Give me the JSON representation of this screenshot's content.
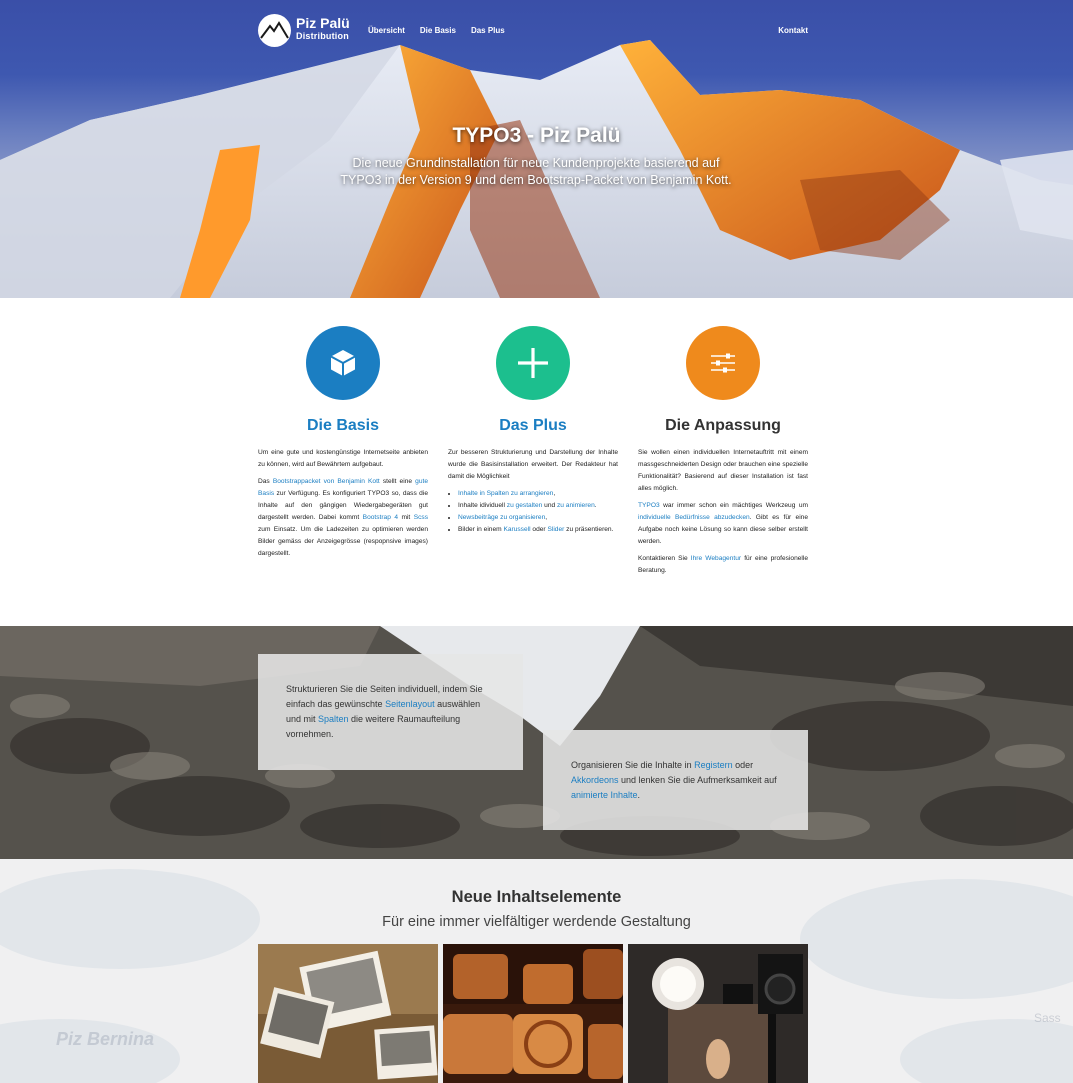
{
  "header": {
    "logo_line1": "Piz Palü",
    "logo_line2": "Distribution",
    "nav": [
      "Übersicht",
      "Die Basis",
      "Das Plus"
    ],
    "contact": "Kontakt"
  },
  "hero": {
    "title": "TYPO3 - Piz Palü",
    "subtitle": "Die neue Grundinstallation für neue Kundenprojekte basierend auf TYPO3 in der Version 9 und dem Bootstrap-Packet von Benjamin Kott."
  },
  "features": {
    "basis": {
      "title": "Die Basis",
      "color": "#1b7ec2",
      "icon": "cube-icon",
      "p1": "Um eine gute und kostengünstige Internetseite anbieten zu können, wird auf Bewährtem aufgebaut.",
      "p2_a": "Das ",
      "p2_link1": "Bootstrappacket von Benjamin Kott",
      "p2_b": " stellt eine ",
      "p2_link2": "gute Basis",
      "p2_c": " zur Verfügung. Es konfiguriert TYPO3 so, dass die Inhalte auf den gängigen Wiedergabegeräten gut dargestellt werden. Dabei kommt ",
      "p2_link3": "Bootstrap 4",
      "p2_d": " mit ",
      "p2_link4": "Scss",
      "p2_e": " zum Einsatz. Um die Ladezeiten zu optimieren werden Bilder gemäss der Anzeigegrösse (respopnsive images) dargestellt."
    },
    "plus": {
      "title": "Das Plus",
      "color": "#1cbf8e",
      "icon": "plus-icon",
      "p1": "Zur besseren Strukturierung und Darstellung der Inhalte wurde die Basisinstallation erweitert. Der Redakteur hat damit die Möglichkeit",
      "li1_link": "Inhalte in Spalten zu arrangieren",
      "li1_after": ",",
      "li2_before": "Inhalte idividuell ",
      "li2_link": "zu gestalten",
      "li2_mid": " und ",
      "li2_link2": "zu animieren",
      "li2_after": ".",
      "li3_link": "Newsbeiträge zu organisieren",
      "li3_after": ",",
      "li4_before": "Bilder in einem ",
      "li4_link1": "Karussell",
      "li4_mid": " oder ",
      "li4_link2": "Slider",
      "li4_after": " zu präsentieren."
    },
    "anpassung": {
      "title": "Die Anpassung",
      "color": "#ef8a1c",
      "icon": "sliders-icon",
      "p1": "Sie wollen einen individuellen Internetauftritt mit einem massgeschneiderten Design oder brauchen eine spezielle Funktionalität? Basierend auf dieser Installation ist fast alles möglich.",
      "p2_link1": "TYPO3",
      "p2_a": " war immer schon ein mächtiges Werkzeug um ",
      "p2_link2": "individuelle Bedürfnisse abzudecken",
      "p2_b": ". Gibt es für eine Aufgabe noch keine Lösung so kann diese selber erstellt werden.",
      "p3_a": "Kontaktieren Sie ",
      "p3_link": "Ihre Webagentur",
      "p3_b": " für eine profesionelle Beratung."
    }
  },
  "rocks": {
    "box1_a": "Strukturieren Sie die Seiten individuell, indem Sie einfach das gewünschte ",
    "box1_link1": "Seitenlayout",
    "box1_b": " auswählen und mit ",
    "box1_link2": "Spalten",
    "box1_c": " die weitere Raumaufteilung vornehmen.",
    "box2_a": "Organisieren Sie die Inhalte in ",
    "box2_link1": "Registern",
    "box2_b": " oder ",
    "box2_link2": "Akkordeons",
    "box2_c": " und lenken Sie die Aufmerksamkeit auf ",
    "box2_link3": "animierte Inhalte",
    "box2_d": "."
  },
  "new_elements": {
    "title": "Neue Inhaltselemente",
    "subtitle": "Für eine immer vielfältiger werdende Gestaltung",
    "watermark_left": "Piz Bernina",
    "watermark_right": "Sass",
    "tiles": [
      "photo-prints-image",
      "stamps-image",
      "camera-studio-image"
    ]
  }
}
